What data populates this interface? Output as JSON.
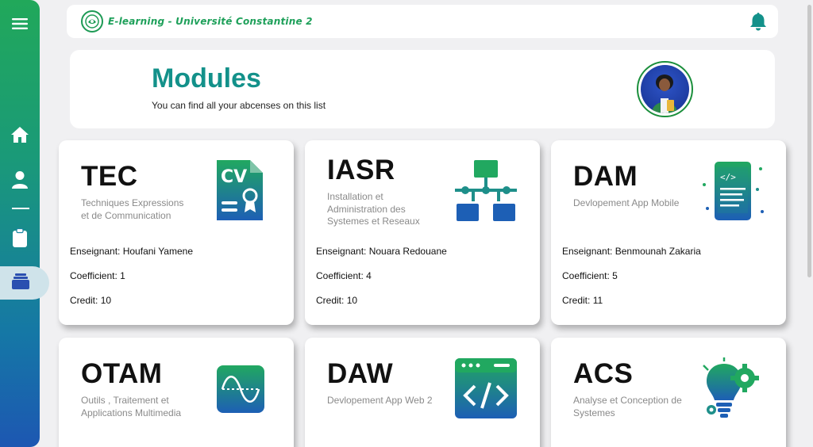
{
  "header": {
    "title": "E-learning - Université Constantine 2"
  },
  "hero": {
    "title": "Modules",
    "subtitle": "You can find all your abcenses on this list"
  },
  "sidebar": {
    "icons": [
      "menu-icon",
      "home-icon",
      "user-icon",
      "clipboard-icon",
      "layers-icon"
    ],
    "active": "layers-icon"
  },
  "labels": {
    "teacher": "Enseignant: ",
    "coefficient": "Coefficient: ",
    "credit": "Credit: "
  },
  "modules": [
    {
      "code": "TEC",
      "name": "Techniques Expressions et de Communication",
      "teacher": "Houfani Yamene",
      "coefficient": "1",
      "credit": "10",
      "icon": "cv-document-icon"
    },
    {
      "code": "IASR",
      "name": "Installation et Administration des Systemes et Reseaux",
      "teacher": "Nouara Redouane",
      "coefficient": "4",
      "credit": "10",
      "icon": "network-icon"
    },
    {
      "code": "DAM",
      "name": "Devlopement App Mobile",
      "teacher": "Benmounah Zakaria",
      "coefficient": "5",
      "credit": "11",
      "icon": "mobile-code-icon"
    },
    {
      "code": "OTAM",
      "name": "Outils , Traitement et Applications Multimedia",
      "icon": "sine-wave-icon"
    },
    {
      "code": "DAW",
      "name": "Devlopement App Web 2",
      "icon": "web-code-icon"
    },
    {
      "code": "ACS",
      "name": "Analyse et Conception de Systemes",
      "icon": "idea-gear-icon"
    }
  ],
  "colors": {
    "accent": "#13918a",
    "brand_green": "#1ea05a",
    "icon_blue": "#1d5fb5"
  }
}
